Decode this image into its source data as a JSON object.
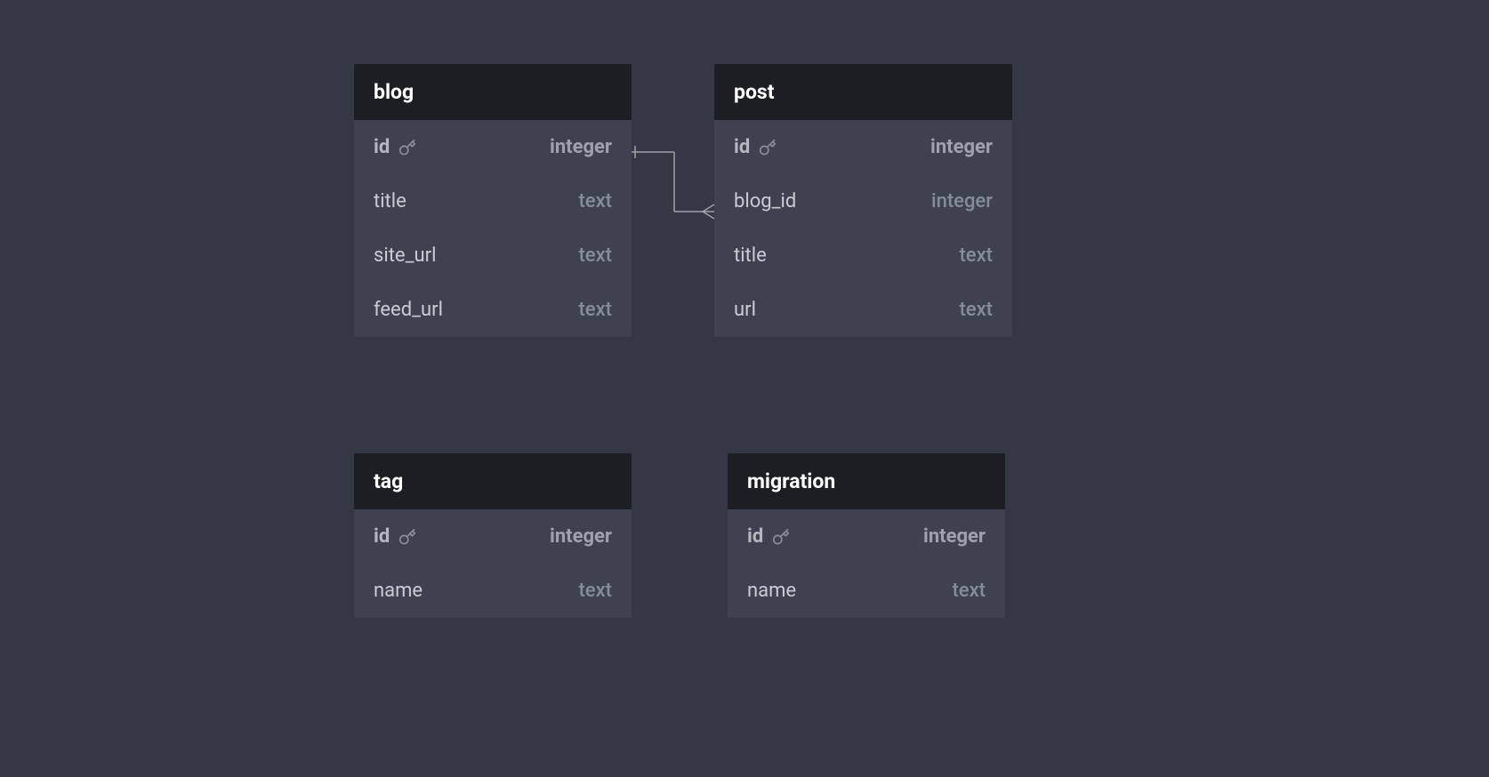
{
  "tables": {
    "blog": {
      "name": "blog",
      "fields": [
        {
          "name": "id",
          "type": "integer",
          "pk": true
        },
        {
          "name": "title",
          "type": "text",
          "pk": false
        },
        {
          "name": "site_url",
          "type": "text",
          "pk": false
        },
        {
          "name": "feed_url",
          "type": "text",
          "pk": false
        }
      ]
    },
    "post": {
      "name": "post",
      "fields": [
        {
          "name": "id",
          "type": "integer",
          "pk": true
        },
        {
          "name": "blog_id",
          "type": "integer",
          "pk": false
        },
        {
          "name": "title",
          "type": "text",
          "pk": false
        },
        {
          "name": "url",
          "type": "text",
          "pk": false
        }
      ]
    },
    "tag": {
      "name": "tag",
      "fields": [
        {
          "name": "id",
          "type": "integer",
          "pk": true
        },
        {
          "name": "name",
          "type": "text",
          "pk": false
        }
      ]
    },
    "migration": {
      "name": "migration",
      "fields": [
        {
          "name": "id",
          "type": "integer",
          "pk": true
        },
        {
          "name": "name",
          "type": "text",
          "pk": false
        }
      ]
    }
  },
  "relationships": [
    {
      "from_table": "blog",
      "from_field": "id",
      "to_table": "post",
      "to_field": "blog_id",
      "type": "one-to-many"
    }
  ]
}
